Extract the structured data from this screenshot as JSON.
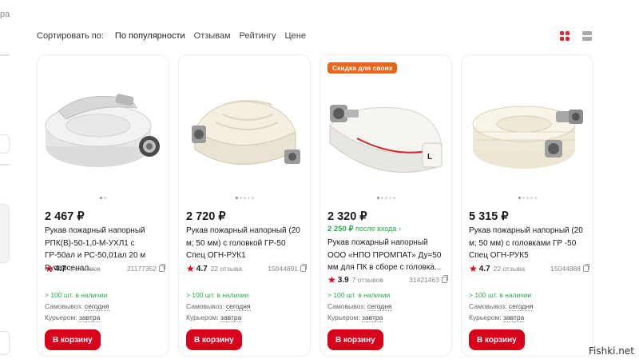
{
  "left_fragment": "ра",
  "sort": {
    "label": "Сортировать по:",
    "options": [
      "По популярности",
      "Отзывам",
      "Рейтингу",
      "Цене"
    ]
  },
  "view_toggle": {
    "active": "grid",
    "accent_color": "#e3262f"
  },
  "colors": {
    "brand_red": "#d9001b",
    "green": "#2aa84a",
    "promo_orange": "#e5671c"
  },
  "cards": [
    {
      "promo": "",
      "price": "2 467 ₽",
      "subprice_value": "",
      "subprice_note": "",
      "title": "Рукав пожарный напорный РПК(В)-50-1,0-М-УХЛ1 с ГР-50ал и РС-50,01ал 20 м Русарсенал...",
      "rating": "4.7",
      "reviews": "6 отзывов",
      "sku": "21177352",
      "stock": "> 100 шт. в наличии",
      "pickup_label": "Самовывоз:",
      "pickup_value": "сегодня",
      "courier_label": "Курьером:",
      "courier_value": "завтра",
      "cart": "В корзину"
    },
    {
      "promo": "",
      "price": "2 720 ₽",
      "subprice_value": "",
      "subprice_note": "",
      "title": "Рукав пожарный напорный (20 м; 50 мм) с головкой ГР-50 Спец ОГН-РУК1",
      "rating": "4.7",
      "reviews": "22 отзыва",
      "sku": "15044891",
      "stock": "> 100 шт. в наличии",
      "pickup_label": "Самовывоз:",
      "pickup_value": "сегодня",
      "courier_label": "Курьером:",
      "courier_value": "завтра",
      "cart": "В корзину"
    },
    {
      "promo": "Скидка для своих",
      "price": "2 320 ₽",
      "subprice_value": "2 250 ₽",
      "subprice_note": "после входа",
      "title": "Рукав пожарный напорный ООО «НПО ПРОМПАТ» Ду=50 мм для ПК в сборе с головка...",
      "rating": "3.9",
      "reviews": "7 отзывов",
      "sku": "31421463",
      "stock": "> 100 шт. в наличии",
      "pickup_label": "Самовывоз:",
      "pickup_value": "сегодня",
      "courier_label": "Курьером:",
      "courier_value": "завтра",
      "cart": "В корзину"
    },
    {
      "promo": "",
      "price": "5 315 ₽",
      "subprice_value": "",
      "subprice_note": "",
      "title": "Рукав пожарный напорный (20 м; 50 мм) с головками ГР -50 Спец ОГН-РУК5",
      "rating": "4.7",
      "reviews": "22 отзыва",
      "sku": "15044888",
      "stock": "> 100 шт. в наличии",
      "pickup_label": "Самовывоз:",
      "pickup_value": "сегодня",
      "courier_label": "Курьером:",
      "courier_value": "завтра",
      "cart": "В корзину"
    }
  ],
  "watermark": "Fishki.net"
}
